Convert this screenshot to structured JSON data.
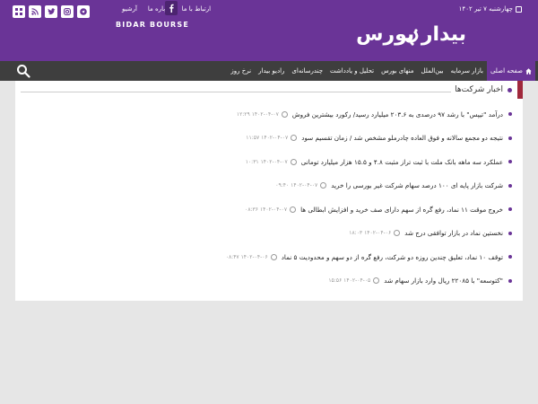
{
  "header": {
    "date": "چهارشنبه ۷ تیر ۱۴۰۲",
    "top_links": [
      "ارتباط با ما",
      "درباره ما",
      "آرشیو"
    ],
    "brand_en": "BIDAR BOURSE",
    "logo_text": "بیدار بورس"
  },
  "social": [
    "facebook-icon",
    "rss-icon",
    "twitter-icon",
    "instagram-icon",
    "telegram-icon",
    "menu-icon"
  ],
  "nav": {
    "items": [
      "صفحه اصلی",
      "بازار سرمایه",
      "بین‌الملل",
      "منهای بورس",
      "تحلیل و یادداشت",
      "چندرسانه‌ای",
      "رادیو بیدار",
      "نرخ روز"
    ]
  },
  "section": {
    "title": "اخبار شرکت‌ها"
  },
  "news": [
    {
      "title": "درآمد \"تیپس\" با رشد ۹۷ درصدی به ۲۰۳.۶ میلیارد رسید/ رکورد بیشترین فروش",
      "time": "۱۴۰۲-۰۴-۰۷ ۱۲:۲۹"
    },
    {
      "title": "نتیجه دو مجمع سالانه و فوق العاده چادرملو مشخص شد / زمان تقسیم سود",
      "time": "۱۴۰۲-۰۴-۰۷ ۱۱:۵۷"
    },
    {
      "title": "عملکرد سه ماهه بانک ملت با ثبت تراز مثبت ۴.۸ و ۱۵.۵ هزار میلیارد تومانی",
      "time": "۱۴۰۲-۰۴-۰۷ ۱۰:۳۱"
    },
    {
      "title": "شرکت بازار پایه ای ۱۰۰ درصد سهام شرکت غیر بورسی را خرید",
      "time": "۱۴۰۲-۰۴-۰۷ ۰۹:۴۰"
    },
    {
      "title": "خروج موقت ۱۱ نماد، رفع گره از سهم دارای صف خرید و افزایش ابطالی ها",
      "time": "۱۴۰۲-۰۴-۰۷ ۰۸:۳۶"
    },
    {
      "title": "نخستین نماد در بازار توافقی درج شد",
      "time": "۱۴۰۲-۰۴-۰۶ ۱۸:۰۳"
    },
    {
      "title": "توقف ۱۰ نماد، تعلیق چندین روزه دو شرکت، رفع گره از دو سهم و محدودیت ۵ نماد",
      "time": "۱۴۰۲-۰۴-۰۶ ۰۸:۴۷"
    },
    {
      "title": "\"کتوسعه\" با ۲۲۰۸۵ ریال وارد بازار سهام شد",
      "time": "۱۴۰۲-۰۴-۰۵ ۱۵:۵۶"
    }
  ],
  "colors": {
    "brand": "#6a3497",
    "nav": "#3e3e3e",
    "accent": "#a0283c"
  }
}
